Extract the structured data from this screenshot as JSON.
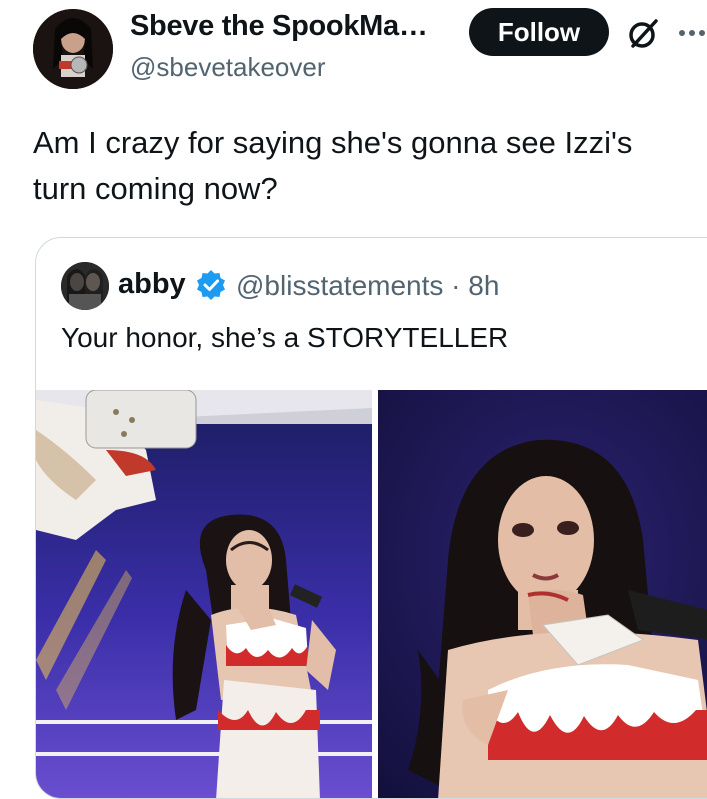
{
  "author": {
    "display_name": "Sbeve the SpookMa…",
    "handle": "@sbevetakeover"
  },
  "actions": {
    "follow_label": "Follow",
    "grok_icon": "grok-icon",
    "more_icon": "more-icon"
  },
  "tweet": {
    "text": "Am I crazy for saying she's gonna see Izzi's turn coming now?"
  },
  "quoted": {
    "name": "abby",
    "handle_time": "@blisstatements · 8h",
    "text": "Your honor, she’s a STORYTELLER",
    "verified_color": "#1d9bf0"
  },
  "colors": {
    "text": "#0f1419",
    "secondary": "#536471",
    "border": "#cfd9de",
    "button_bg": "#0f1419"
  }
}
